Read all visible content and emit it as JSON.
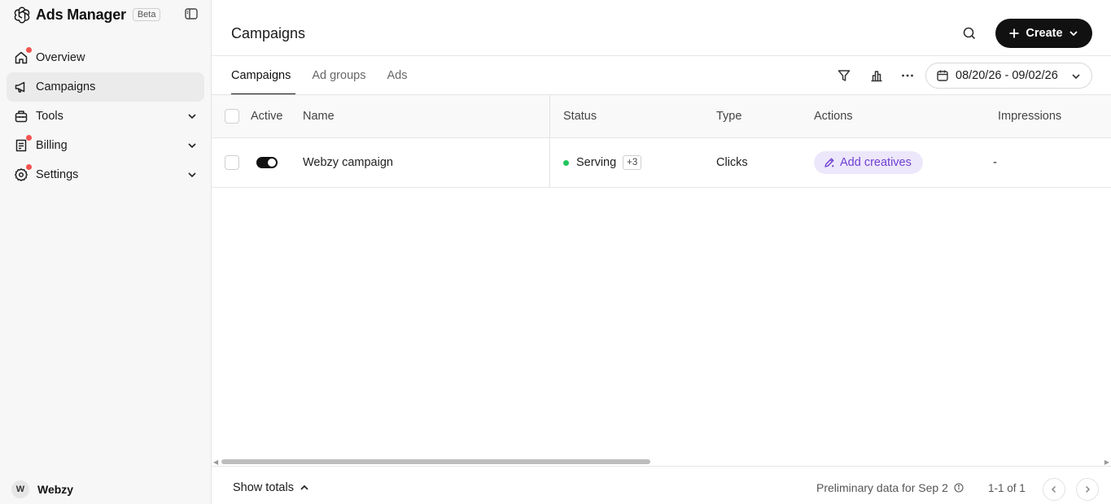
{
  "brand": {
    "title": "Ads Manager",
    "badge": "Beta"
  },
  "sidebar": {
    "items": [
      {
        "label": "Overview",
        "icon": "home-icon",
        "has_dot": true
      },
      {
        "label": "Campaigns",
        "icon": "megaphone-icon",
        "active": true
      },
      {
        "label": "Tools",
        "icon": "toolbox-icon",
        "expandable": true
      },
      {
        "label": "Billing",
        "icon": "receipt-icon",
        "has_dot": true,
        "expandable": true
      },
      {
        "label": "Settings",
        "icon": "gear-icon",
        "has_dot": true,
        "expandable": true
      }
    ],
    "account": {
      "initial": "W",
      "name": "Webzy"
    }
  },
  "header": {
    "title": "Campaigns",
    "create_label": "Create"
  },
  "tabs": [
    {
      "label": "Campaigns",
      "active": true
    },
    {
      "label": "Ad groups"
    },
    {
      "label": "Ads"
    }
  ],
  "toolbar": {
    "date_range": "08/20/26 - 09/02/26"
  },
  "table": {
    "columns": {
      "active": "Active",
      "name": "Name",
      "status": "Status",
      "type": "Type",
      "actions": "Actions",
      "impressions": "Impressions"
    },
    "rows": [
      {
        "active": true,
        "name": "Webzy campaign",
        "status": "Serving",
        "status_extra": "+3",
        "type": "Clicks",
        "action": "Add creatives",
        "impressions": "-"
      }
    ]
  },
  "footer": {
    "show_totals": "Show totals",
    "preliminary": "Preliminary data for Sep 2",
    "page_count": "1-1 of 1"
  },
  "colors": {
    "accent": "#111111",
    "action_bg": "#ede7fb",
    "action_text": "#6f3fd1",
    "status_ok": "#22c55e",
    "notification_dot": "#f0524f"
  }
}
